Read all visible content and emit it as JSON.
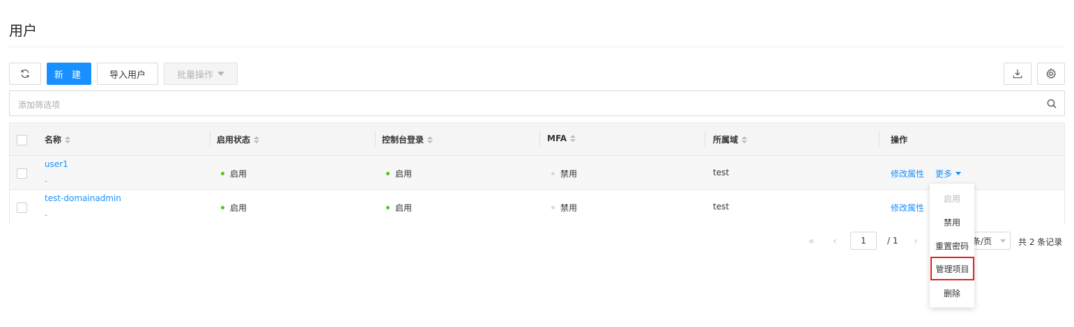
{
  "page": {
    "title": "用户"
  },
  "toolbar": {
    "new_label": "新 建",
    "import_label": "导入用户",
    "batch_label": "批量操作"
  },
  "filter": {
    "placeholder": "添加筛选项"
  },
  "table": {
    "columns": [
      "名称",
      "启用状态",
      "控制台登录",
      "MFA",
      "所属域",
      "操作"
    ],
    "rows": [
      {
        "name": "user1",
        "description": "-",
        "status": "启用",
        "console_login": "启用",
        "mfa": "禁用",
        "domain": "test",
        "action_edit": "修改属性",
        "action_more": "更多"
      },
      {
        "name": "test-domainadmin",
        "description": "-",
        "status": "启用",
        "console_login": "启用",
        "mfa": "禁用",
        "domain": "test",
        "action_edit": "修改属性"
      }
    ]
  },
  "pagination": {
    "current_page": "1",
    "total_pages": "/ 1",
    "page_size_suffix": "条/页",
    "summary": "共 2 条记录"
  },
  "more_menu": {
    "items": [
      {
        "label": "启用",
        "disabled": true
      },
      {
        "label": "禁用"
      },
      {
        "label": "重置密码"
      },
      {
        "label": "管理项目",
        "highlighted": true
      },
      {
        "label": "删除"
      }
    ]
  },
  "colors": {
    "primary": "#1890ff",
    "status_enabled": "#52c41a",
    "status_disabled": "#d9d9d9",
    "highlight_border": "#e02020"
  }
}
